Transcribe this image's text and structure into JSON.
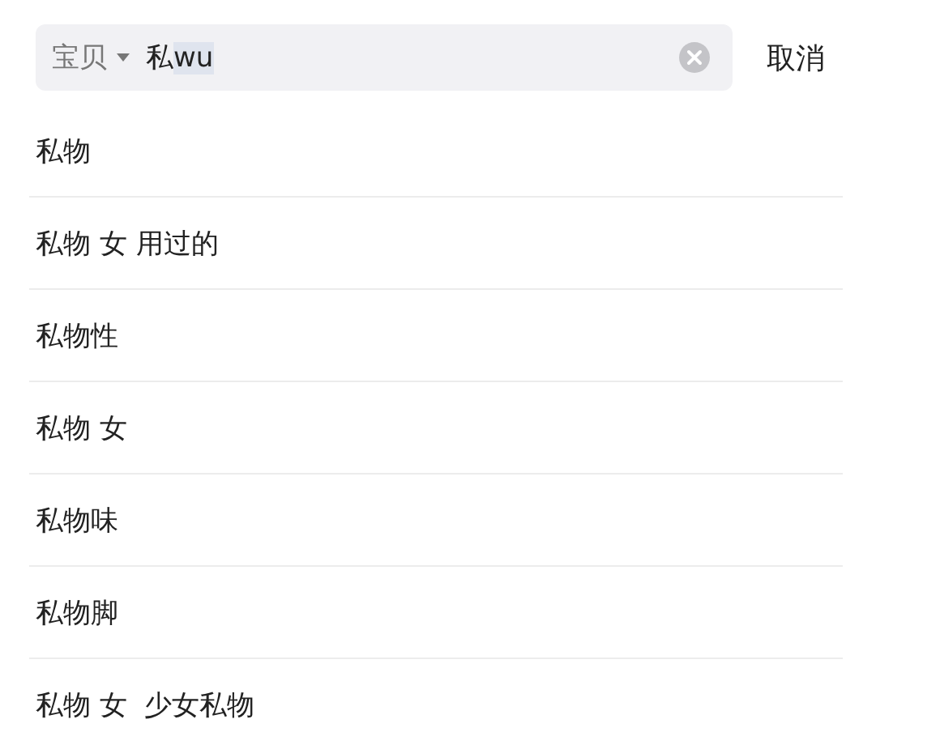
{
  "search": {
    "scope": "宝贝",
    "value": "私",
    "composition": "wu"
  },
  "cancel": "取消",
  "suggestions": [
    "私物",
    "私物 女 用过的",
    "私物性",
    "私物 女",
    "私物味",
    "私物脚",
    "私物 女  少女私物"
  ]
}
